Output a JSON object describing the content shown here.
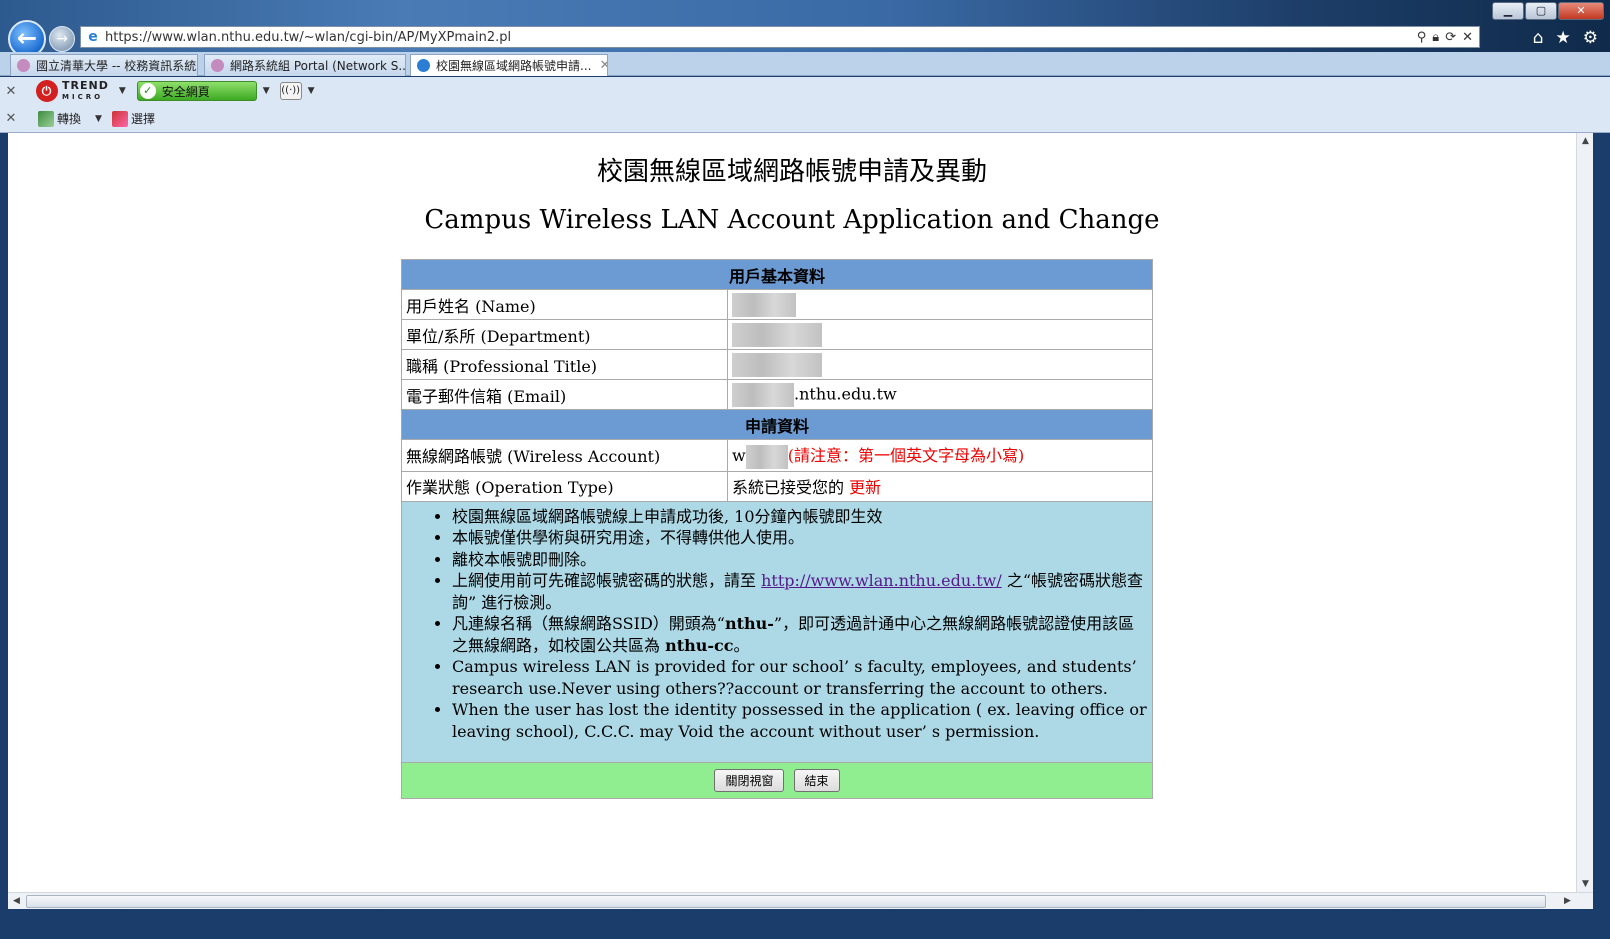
{
  "browser": {
    "window_controls": {
      "minimize": "▁",
      "maximize": "▢",
      "close": "✕"
    },
    "back_glyph": "←",
    "forward_glyph": "→",
    "url": "https://www.wlan.nthu.edu.tw/~wlan/cgi-bin/AP/MyXPmain2.pl",
    "tabs": [
      {
        "label": "國立清華大學 -- 校務資訊系統"
      },
      {
        "label": "網路系統組 Portal (Network S..."
      },
      {
        "label": "校園無線區域網路帳號申請..."
      }
    ],
    "tab_close": "✕",
    "toolbar1": {
      "close": "✕",
      "trend_label": "TREND",
      "trend_sub": "MICRO",
      "safe_label": "安全網頁"
    },
    "toolbar2": {
      "close": "✕",
      "convert_label": "轉換",
      "select_label": "選擇"
    }
  },
  "page": {
    "title_zh": "校園無線區域網路帳號申請及異動",
    "title_en": "Campus Wireless LAN Account Application and Change",
    "section_user": "用戶基本資料",
    "fields": {
      "name_label": "用戶姓名 (Name)",
      "dept_label": "單位/系所 (Department)",
      "title_label": "職稱 (Professional Title)",
      "email_label": "電子郵件信箱 (Email)",
      "email_suffix": ".nthu.edu.tw"
    },
    "section_apply": "申請資料",
    "apply": {
      "account_label": "無線網路帳號 (Wireless Account)",
      "account_prefix": "w",
      "account_note": "(請注意：第一個英文字母為小寫)",
      "operation_label": "作業狀態 (Operation Type)",
      "operation_text": "系統已接受您的 ",
      "operation_value": "更新"
    },
    "notes": {
      "n1": "校園無線區域網路帳號線上申請成功後, 10分鐘內帳號即生效",
      "n2": "本帳號僅供學術與研究用途，不得轉供他人使用。",
      "n3": "離校本帳號即刪除。",
      "n4_pre": "上網使用前可先確認帳號密碼的狀態，請至 ",
      "n4_link": "http://www.wlan.nthu.edu.tw/",
      "n4_post": " 之“帳號密碼狀態查詢” 進行檢測。",
      "n5_pre": "凡連線名稱（無線網路SSID）開頭為“",
      "n5_bold1": "nthu-",
      "n5_mid": "”，即可透過計通中心之無線網路帳號認證使用該區之無線網路，如校園公共區為 ",
      "n5_bold2": "nthu-cc",
      "n5_post": "。",
      "n6": "Campus wireless LAN is provided for our school’ s faculty, employees, and students’ research use.Never using others??account or transferring the account to others.",
      "n7": "When the user has lost the identity possessed in the application ( ex. leaving office or leaving school), C.C.C. may Void the account without user’ s permission."
    },
    "buttons": {
      "close_window": "關閉視窗",
      "finish": "結束"
    }
  }
}
